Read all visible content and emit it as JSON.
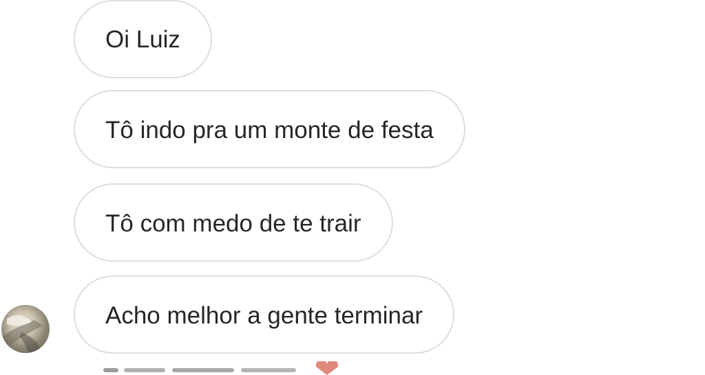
{
  "chat": {
    "messages": [
      {
        "text": "Oi Luiz"
      },
      {
        "text": "Tô indo pra um monte de festa"
      },
      {
        "text": "Tô com medo de te trair"
      },
      {
        "text": "Acho melhor a gente terminar"
      }
    ],
    "sender_avatar": {
      "icon": "profile-photo"
    },
    "colors": {
      "bubble_border": "#dedede",
      "text": "#262626",
      "background": "#ffffff"
    }
  }
}
